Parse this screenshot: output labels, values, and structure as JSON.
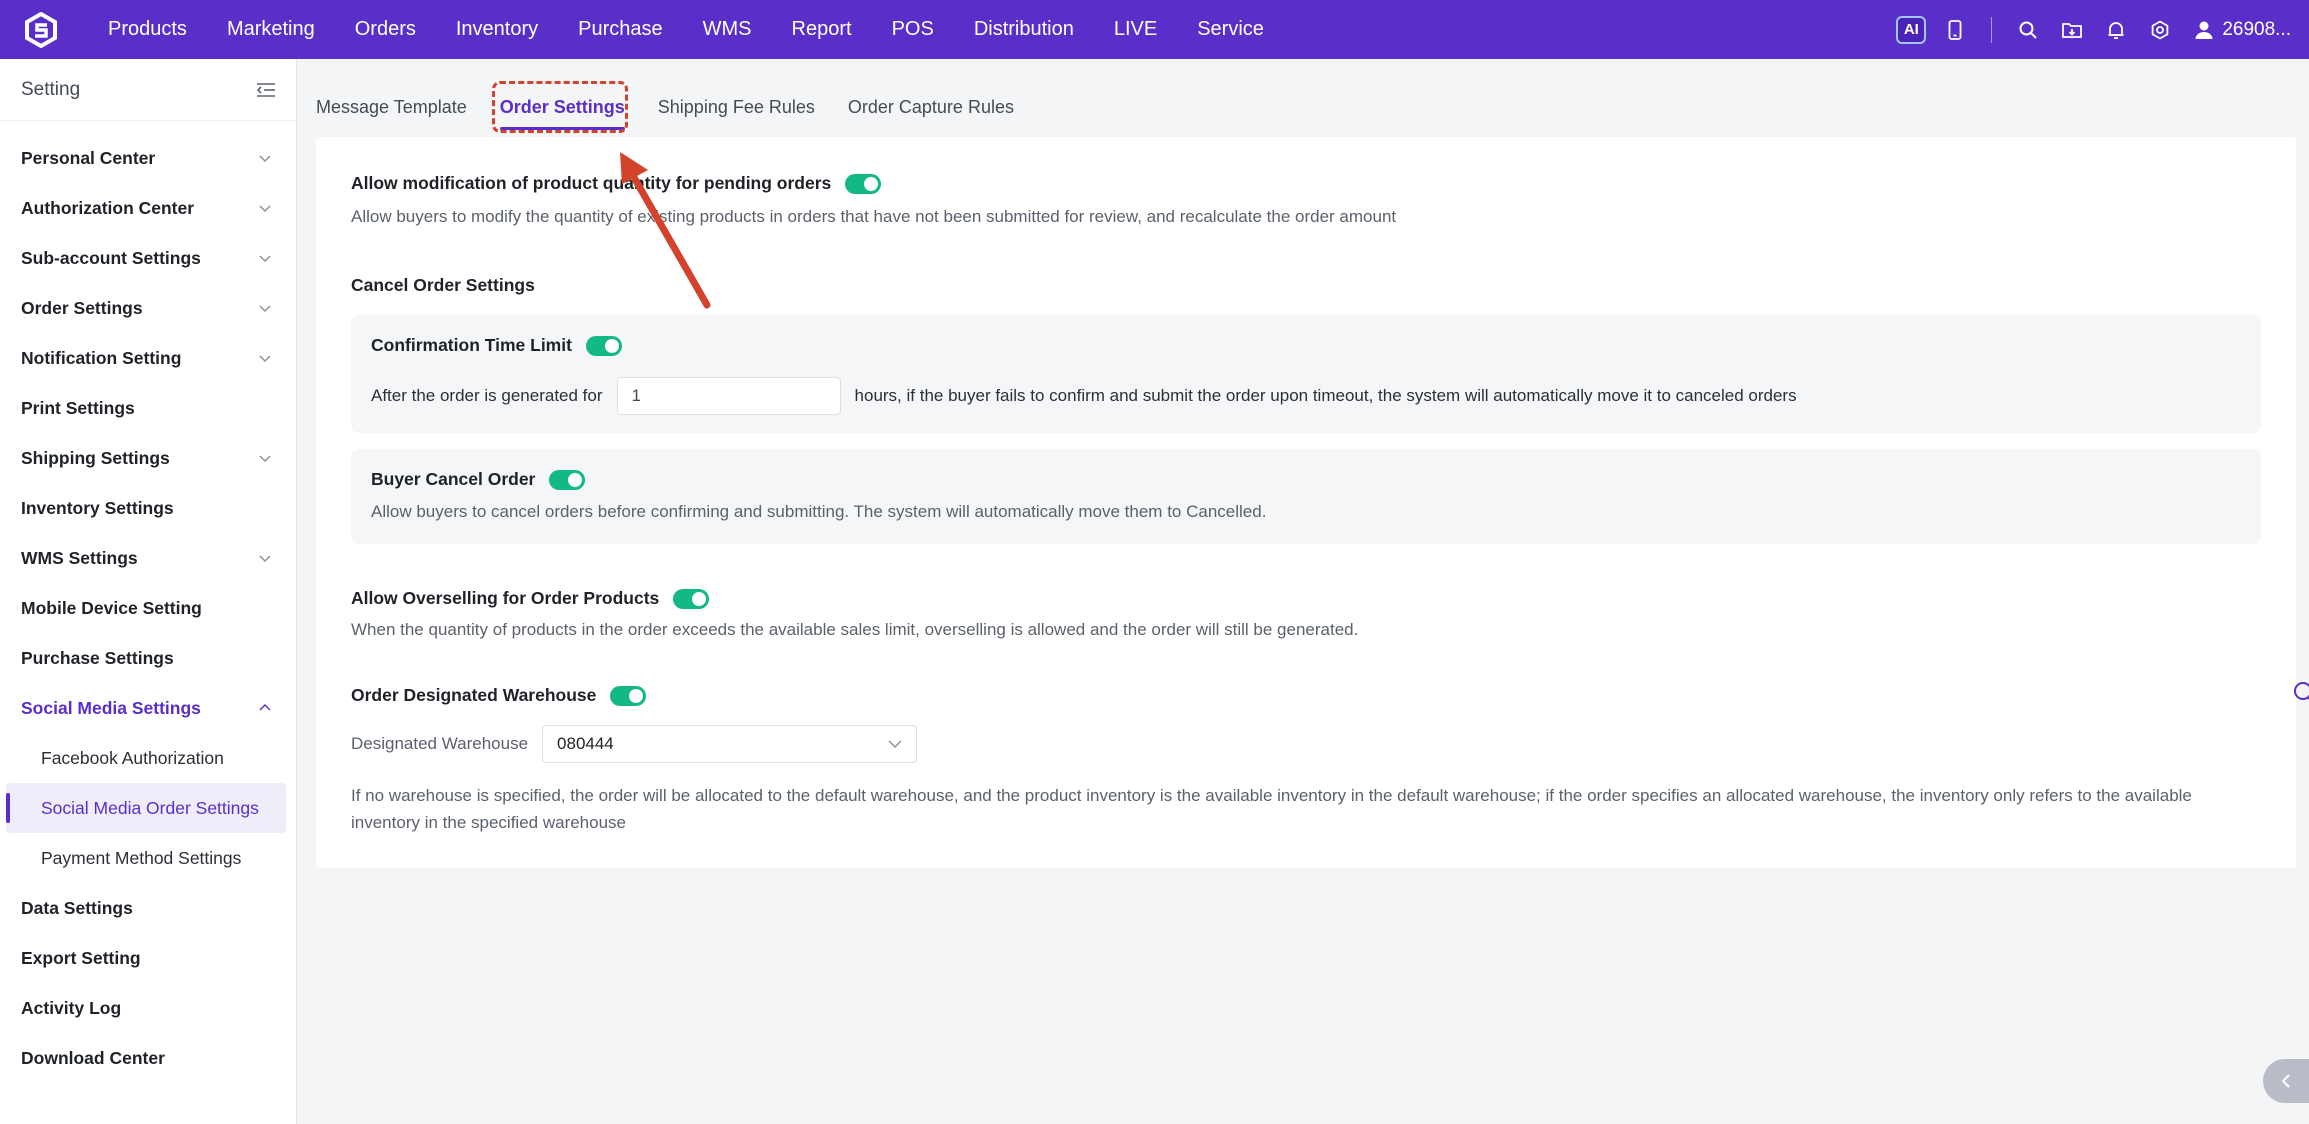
{
  "topnav": {
    "items": [
      "Products",
      "Marketing",
      "Orders",
      "Inventory",
      "Purchase",
      "WMS",
      "Report",
      "POS",
      "Distribution",
      "LIVE",
      "Service"
    ],
    "ai_label": "AI",
    "user_name": "26908..."
  },
  "sidebar": {
    "title": "Setting",
    "items": [
      {
        "label": "Personal Center",
        "expandable": true
      },
      {
        "label": "Authorization Center",
        "expandable": true
      },
      {
        "label": "Sub-account Settings",
        "expandable": true
      },
      {
        "label": "Order Settings",
        "expandable": true
      },
      {
        "label": "Notification Setting",
        "expandable": true
      },
      {
        "label": "Print Settings",
        "expandable": false
      },
      {
        "label": "Shipping Settings",
        "expandable": true
      },
      {
        "label": "Inventory Settings",
        "expandable": false
      },
      {
        "label": "WMS Settings",
        "expandable": true
      },
      {
        "label": "Mobile Device Setting",
        "expandable": false
      },
      {
        "label": "Purchase Settings",
        "expandable": false
      },
      {
        "label": "Social Media Settings",
        "expandable": true,
        "expanded": true
      },
      {
        "label": "Data Settings",
        "expandable": false
      },
      {
        "label": "Export Setting",
        "expandable": false
      },
      {
        "label": "Activity Log",
        "expandable": false
      },
      {
        "label": "Download Center",
        "expandable": false
      }
    ],
    "sub_items": [
      "Facebook Authorization",
      "Social Media Order Settings",
      "Payment Method Settings"
    ],
    "selected_sub": "Social Media Order Settings"
  },
  "tabs": [
    "Message Template",
    "Order Settings",
    "Shipping Fee Rules",
    "Order Capture Rules"
  ],
  "active_tab": "Order Settings",
  "content": {
    "modify_qty": {
      "title": "Allow modification of product quantity for pending orders",
      "desc": "Allow buyers to modify the quantity of existing products in orders that have not been submitted for review, and recalculate the order amount",
      "enabled": true
    },
    "cancel_settings_title": "Cancel Order Settings",
    "confirmation": {
      "title": "Confirmation Time Limit",
      "enabled": true,
      "prefix": "After the order is generated for",
      "value": "1",
      "suffix": "hours, if the buyer fails to confirm and submit the order upon timeout, the system will automatically move it to canceled orders"
    },
    "buyer_cancel": {
      "title": "Buyer Cancel Order",
      "enabled": true,
      "desc": "Allow buyers to cancel orders before confirming and submitting. The system will automatically move them to Cancelled."
    },
    "overselling": {
      "title": "Allow Overselling for Order Products",
      "enabled": true,
      "desc": "When the quantity of products in the order exceeds the available sales limit, overselling is allowed and the order will still be generated."
    },
    "warehouse": {
      "title": "Order Designated Warehouse",
      "enabled": true,
      "label": "Designated Warehouse",
      "value": "080444",
      "desc_line1": "If no warehouse is specified, the order will be allocated to the default warehouse, and the product inventory is the available inventory in the default warehouse; if the order specifies an allocated warehouse, the inventory only refers to the available",
      "desc_line2": "inventory in the specified warehouse"
    }
  },
  "colors": {
    "brand": "#5a2fc9",
    "toggle_on": "#12b886",
    "annotation": "#d3432b"
  }
}
